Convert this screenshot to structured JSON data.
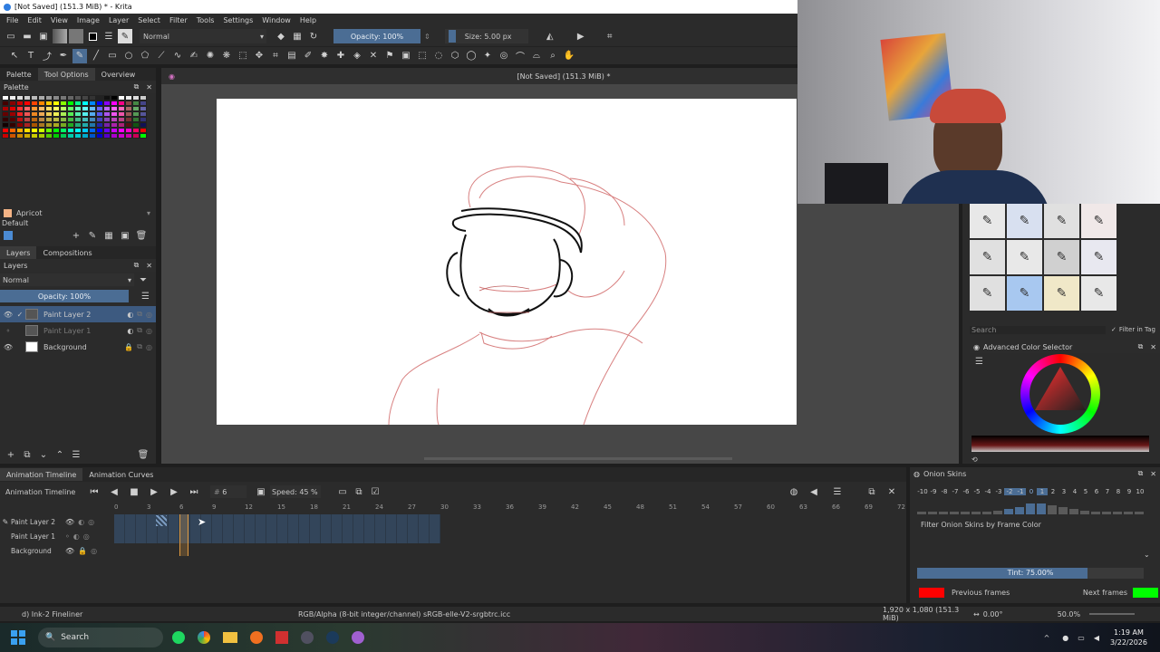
{
  "window": {
    "title": "[Not Saved]  (151.3 MiB) * - Krita"
  },
  "menu": [
    "File",
    "Edit",
    "View",
    "Image",
    "Layer",
    "Select",
    "Filter",
    "Tools",
    "Settings",
    "Window",
    "Help"
  ],
  "toolbar": {
    "blend_mode": "Normal",
    "opacity": "Opacity: 100%",
    "size": "Size: 5.00 px"
  },
  "canvas": {
    "doc_title": "[Not Saved]  (151.3 MiB) *"
  },
  "palette": {
    "title": "Palette",
    "tabs": [
      "Palette",
      "Tool Options",
      "Overview"
    ],
    "color_name": "Apricot",
    "set_name": "Default"
  },
  "layers_panel": {
    "tabs": [
      "Layers",
      "Compositions"
    ],
    "title": "Layers",
    "blend": "Normal",
    "opacity": "Opacity: 100%",
    "layers": [
      {
        "name": "Paint Layer 2",
        "active": true
      },
      {
        "name": "Paint Layer 1",
        "active": false
      },
      {
        "name": "Background",
        "active": false
      }
    ]
  },
  "brushes": {
    "search_placeholder": "Search",
    "filter_label": "Filter in Tag"
  },
  "color_selector": {
    "title": "Advanced Color Selector"
  },
  "timeline": {
    "tabs": [
      "Animation Timeline",
      "Animation Curves"
    ],
    "title": "Animation Timeline",
    "frame": "6",
    "speed": "Speed: 45 %",
    "ruler": [
      "0",
      "3",
      "6",
      "9",
      "12",
      "15",
      "18",
      "21",
      "24",
      "27",
      "30",
      "33",
      "36",
      "39",
      "42",
      "45",
      "48",
      "51",
      "54",
      "57",
      "60",
      "63",
      "66",
      "69",
      "72"
    ],
    "layers": [
      "Paint Layer 2",
      "Paint Layer 1",
      "Background"
    ]
  },
  "onion": {
    "title": "Onion Skins",
    "numbers": [
      "-10",
      "-9",
      "-8",
      "-7",
      "-6",
      "-5",
      "-4",
      "-3",
      "-2",
      "-1",
      "0",
      "1",
      "2",
      "3",
      "4",
      "5",
      "6",
      "7",
      "8",
      "9",
      "10"
    ],
    "filter_label": "Filter Onion Skins by Frame Color",
    "tint": "Tint: 75.00%",
    "tint_fraction": 0.75,
    "previous_label": "Previous frames",
    "next_label": "Next frames",
    "previous_color": "#ff0000",
    "next_color": "#00ff00"
  },
  "statusbar": {
    "brush": "d) Ink-2 Fineliner",
    "colorspace": "RGB/Alpha (8-bit integer/channel)  sRGB-elle-V2-srgbtrc.icc",
    "dims": "1,920 x 1,080 (151.3 MiB)",
    "rotation": "0.00°",
    "zoom": "50.0%"
  },
  "taskbar": {
    "search": "Search",
    "time": "1:19 AM",
    "date": "3/22/2026"
  }
}
